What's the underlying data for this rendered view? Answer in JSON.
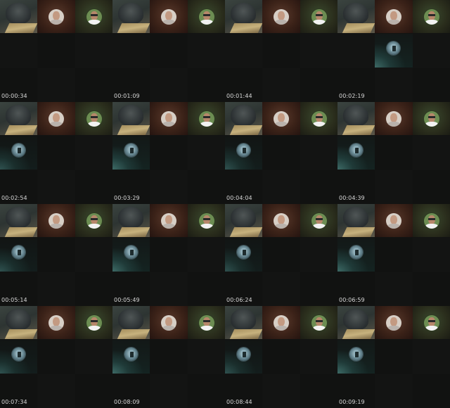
{
  "frames": [
    {
      "timestamp": "00:00:34"
    },
    {
      "timestamp": "00:01:09"
    },
    {
      "timestamp": "00:01:44"
    },
    {
      "timestamp": "00:02:19"
    },
    {
      "timestamp": "00:02:54"
    },
    {
      "timestamp": "00:03:29"
    },
    {
      "timestamp": "00:04:04"
    },
    {
      "timestamp": "00:04:39"
    },
    {
      "timestamp": "00:05:14"
    },
    {
      "timestamp": "00:05:49"
    },
    {
      "timestamp": "00:06:24"
    },
    {
      "timestamp": "00:06:59"
    },
    {
      "timestamp": "00:07:34"
    },
    {
      "timestamp": "00:08:09"
    },
    {
      "timestamp": "00:08:44"
    },
    {
      "timestamp": "00:09:19"
    }
  ],
  "tiles": {
    "first_row": [
      "panther-image",
      "portrait-image",
      "portrait-image"
    ],
    "shared_screen": "camera-globe-image"
  },
  "colors": {
    "background": "#101110",
    "timestamp_text": "#d9d9d9"
  }
}
